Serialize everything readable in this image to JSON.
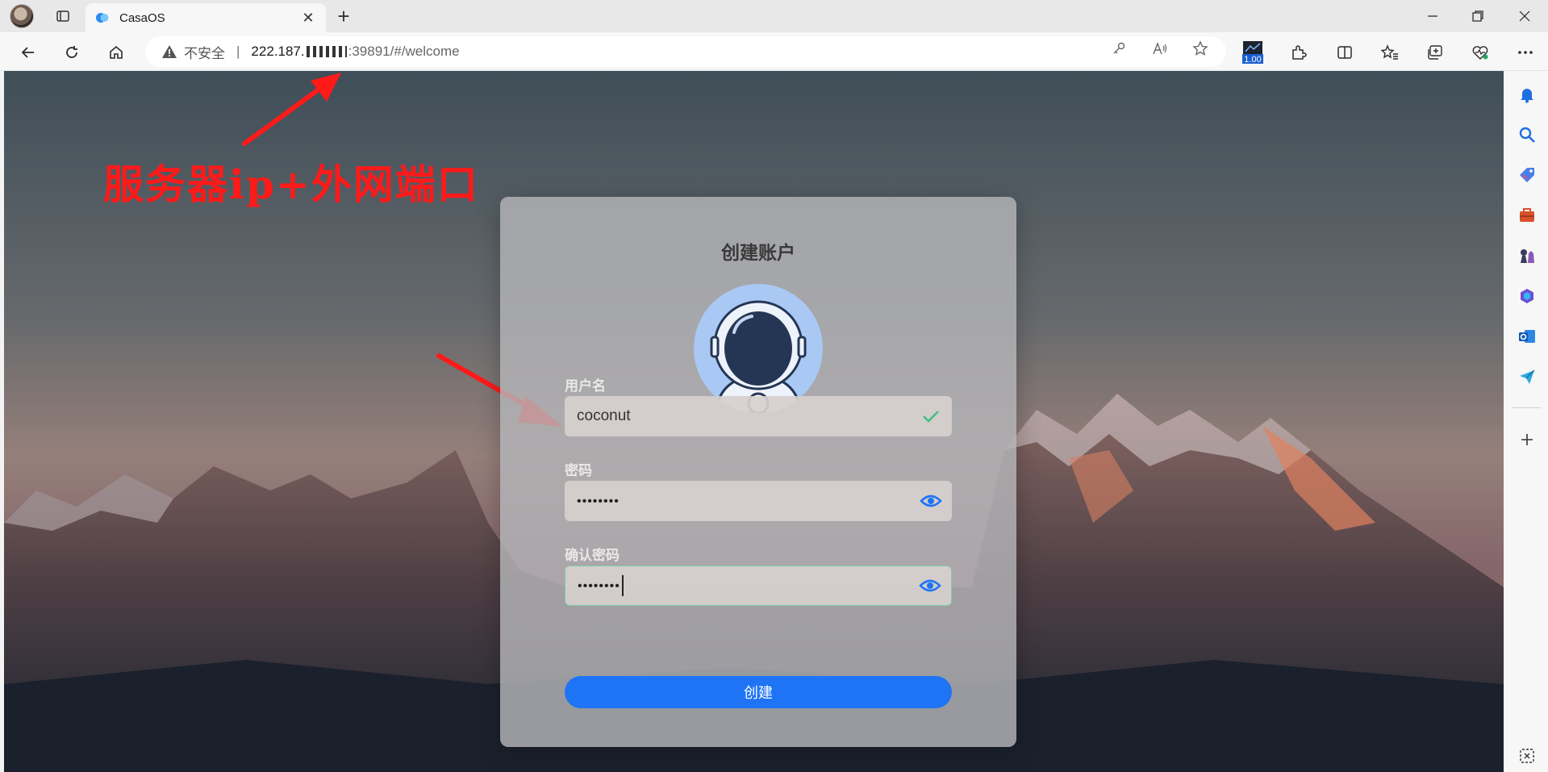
{
  "browser": {
    "tab_title": "CasaOS",
    "address": {
      "security_label": "不安全",
      "separator": "|",
      "host_prefix": "222.187.",
      "port_path": ":39891/#/welcome"
    },
    "extension_badge": "1.00"
  },
  "annotation": {
    "text": "服务器ip+外网端口"
  },
  "page": {
    "title": "创建账户",
    "username_label": "用户名",
    "username_value": "coconut",
    "password_label": "密码",
    "password_value": "••••••••",
    "confirm_label": "确认密码",
    "confirm_value": "••••••••",
    "submit_label": "创建"
  },
  "colors": {
    "accent": "#1f74f5",
    "valid": "#3fbf7f",
    "annotation_red": "#ff1a1a"
  }
}
